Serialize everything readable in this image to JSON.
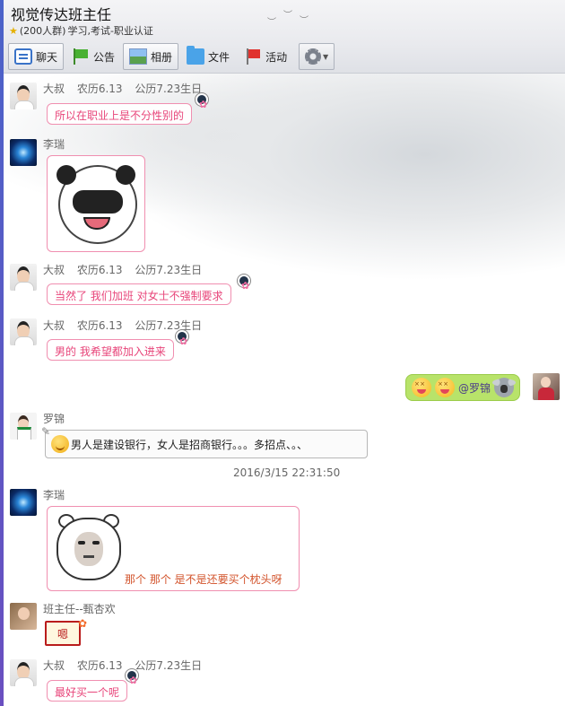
{
  "window": {
    "title": "视觉传达班主任",
    "subtitle_count": "(200人群)",
    "subtitle_category": "学习,考试-职业认证"
  },
  "toolbar": {
    "chat": "聊天",
    "notice": "公告",
    "album": "相册",
    "files": "文件",
    "activity": "活动"
  },
  "scroll_indicator": "^",
  "messages": [
    {
      "sender": "大叔",
      "tag_lunar": "农历6.13",
      "tag_solar": "公历7.23生日",
      "text": "所以在职业上是不分性别的"
    },
    {
      "sender": "李瑞",
      "sticker": "panda-covering-face"
    },
    {
      "sender": "大叔",
      "tag_lunar": "农历6.13",
      "tag_solar": "公历7.23生日",
      "text": "当然了 我们加班 对女士不强制要求"
    },
    {
      "sender": "大叔",
      "tag_lunar": "农历6.13",
      "tag_solar": "公历7.23生日",
      "text": "男的 我希望都加入进来"
    },
    {
      "sender": "self",
      "mention": "@罗锦"
    },
    {
      "sender": "罗锦",
      "text": "男人是建设银行，女人是招商银行。。。多招点、。、"
    },
    {
      "timestamp": "2016/3/15 22:31:50"
    },
    {
      "sender": "李瑞",
      "sticker": "bear-face",
      "caption": "那个 那个 是不是还要买个枕头呀"
    },
    {
      "sender": "班主任--甄杏欢",
      "sticker_text": "嗯"
    },
    {
      "sender": "大叔",
      "tag_lunar": "农历6.13",
      "tag_solar": "公历7.23生日",
      "text": "最好买一个呢"
    }
  ]
}
